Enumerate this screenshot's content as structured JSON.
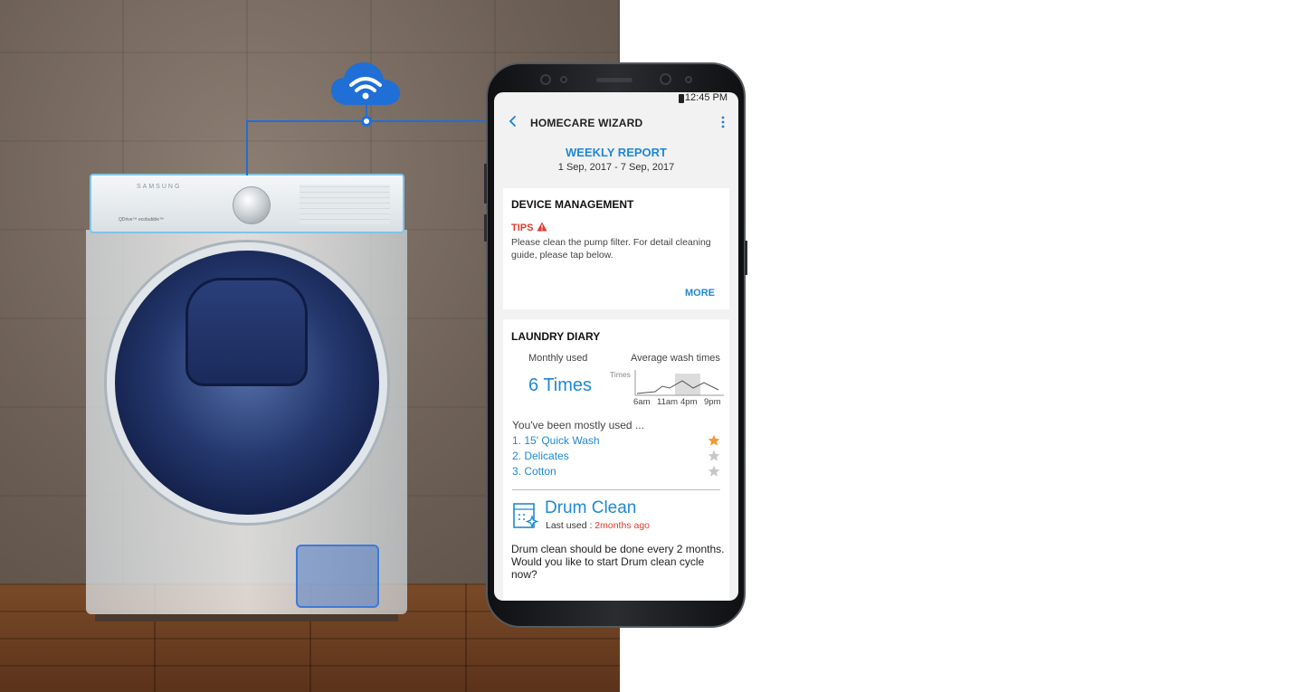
{
  "status_bar": {
    "time": "12:45 PM"
  },
  "app_bar": {
    "title": "HOMECARE WIZARD"
  },
  "report": {
    "title": "WEEKLY REPORT",
    "date_range": "1 Sep, 2017 - 7 Sep, 2017"
  },
  "device_management": {
    "title": "DEVICE MANAGEMENT",
    "tips_label": "TIPS",
    "tips_text": "Please clean the pump filter. For detail cleaning guide, please tap below.",
    "more_label": "MORE"
  },
  "laundry_diary": {
    "title": "LAUNDRY DIARY",
    "monthly_label": "Monthly used",
    "monthly_value": "6 Times",
    "average_label": "Average wash times",
    "spark_y_label": "Times",
    "spark_ticks": [
      "6am",
      "11am",
      "4pm",
      "9pm"
    ],
    "mostly_label": "You've been mostly used ...",
    "ranking": [
      {
        "label": "1. 15' Quick Wash",
        "favorite": true
      },
      {
        "label": "2. Delicates",
        "favorite": false
      },
      {
        "label": "3. Cotton",
        "favorite": false
      }
    ]
  },
  "drum_clean": {
    "title": "Drum Clean",
    "last_used_label": "Last used : ",
    "last_used_value": "2months ago",
    "message": "Drum clean should be done every 2 months. Would you like to start Drum clean cycle now?"
  },
  "washer": {
    "brand": "SAMSUNG",
    "sub_label": "QDrive™  ecobubble™"
  },
  "icons": {
    "cloud": "wifi-cloud-icon",
    "back": "chevron-left-icon",
    "more": "more-vertical-icon",
    "warning": "warning-triangle-icon",
    "star": "star-icon",
    "drum": "drum-clean-icon"
  },
  "colors": {
    "accent": "#1f88d4",
    "alert": "#e03a2e",
    "star_active": "#f29a2e",
    "star_inactive": "#c8c8c8",
    "connection": "#1f6fd6"
  }
}
